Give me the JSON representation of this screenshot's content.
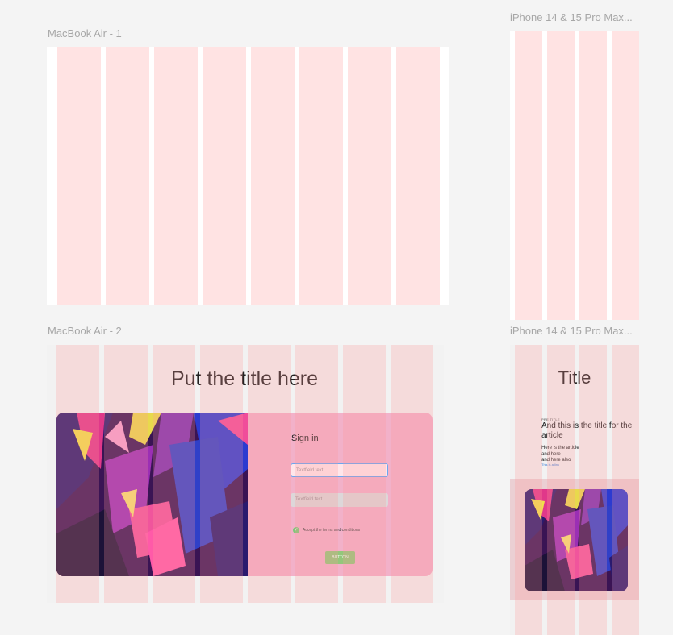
{
  "frames": {
    "macbook1": {
      "label": "MacBook Air - 1"
    },
    "iphone1": {
      "label": "iPhone 14 & 15 Pro Max..."
    },
    "macbook2": {
      "label": "MacBook Air - 2",
      "title": "Put the title here",
      "sign_in_heading": "Sign in",
      "textfield1_placeholder": "Textfield text",
      "textfield2_placeholder": "Textfield text",
      "checkbox_label": "Accept the terms and conditions",
      "checkbox_checked": true,
      "button_label": "BUTTON"
    },
    "iphone2": {
      "label": "iPhone 14 & 15 Pro Max...",
      "title": "Title",
      "pre_title": "PRE TITLE",
      "article_title": "And this is the title for the article",
      "article_body": [
        "Here is the article",
        "and here",
        "and here also"
      ],
      "link_text": "This is a link"
    }
  },
  "colors": {
    "canvas": "#f4f4f4",
    "layout_grid_column": "#ffe3e3",
    "card_pink": "#f2b1c9",
    "button_green": "#93c77b",
    "focus_border": "#6aa6f0"
  }
}
